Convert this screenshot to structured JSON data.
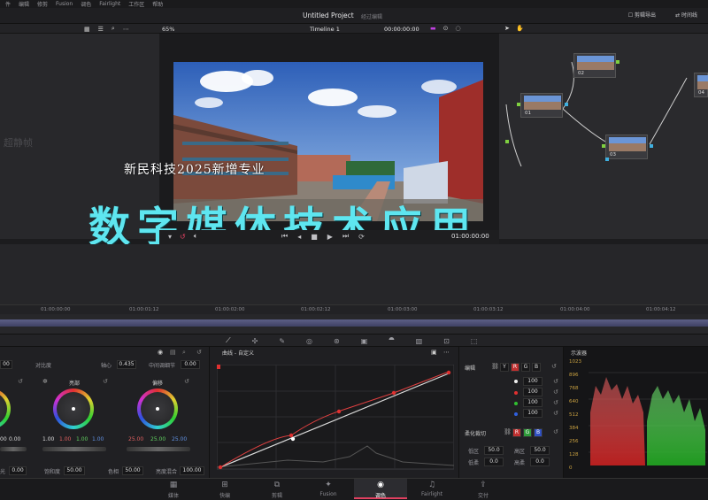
{
  "menubar": {
    "items": [
      "件",
      "编辑",
      "修剪",
      "Fusion",
      "调色",
      "Fairlight",
      "工作区",
      "帮助"
    ]
  },
  "titlebar": {
    "title": "Untitled Project",
    "subtitle": "经过编辑",
    "right": [
      "☐ 剪辑导出",
      "⇄ 时间线"
    ]
  },
  "viewer_toolbar": {
    "zoom": "65%",
    "timeline": "Timeline 1",
    "timecode": "00:00:00:00"
  },
  "gallery": {
    "ghost_text": "超静帧"
  },
  "overlay": {
    "caption_small": "新民科技2025新增专业",
    "caption_big": "数字媒体技术应用"
  },
  "playbar": {
    "timecode": "01:00:00:00"
  },
  "nodes": [
    {
      "label": "01"
    },
    {
      "label": "02"
    },
    {
      "label": "03"
    },
    {
      "label": "04"
    }
  ],
  "ruler": {
    "ticks": [
      "01:00:00:00",
      "01:00:01:12",
      "01:00:02:00",
      "01:00:02:12",
      "01:00:03:00",
      "01:00:03:12",
      "01:00:04:00",
      "01:00:04:12"
    ]
  },
  "wheels": {
    "top_labels": {
      "contrast_value": "00",
      "pivot_label": "对比度",
      "pivot": "轴心",
      "pivot_value": "0.435",
      "mid_label": "中间调细节",
      "mid_value": "0.00"
    },
    "wheel1": {
      "values": [
        "00",
        "0.00"
      ]
    },
    "wheel2": {
      "title": "亮部",
      "values": [
        "1.00",
        "1.00",
        "1.00",
        "1.00"
      ]
    },
    "wheel3": {
      "title": "偏移",
      "values": [
        "25.00",
        "25.00",
        "25.00"
      ]
    },
    "bottom": {
      "l1": "光",
      "v1": "0.00",
      "l2": "饱和度",
      "v2": "50.00",
      "l3": "色相",
      "v3": "50.00",
      "l4": "亮度混合",
      "v4": "100.00"
    }
  },
  "curves": {
    "title": "曲线 - 自定义"
  },
  "channels": {
    "title": "编辑",
    "buttons": [
      "Y",
      "R",
      "G",
      "B"
    ],
    "values": [
      "100",
      "100",
      "100",
      "100"
    ],
    "soft_title": "柔化裁切",
    "soft_buttons": [
      "R",
      "G",
      "B"
    ],
    "low_label": "低区",
    "low_value": "50.0",
    "high_label": "高区",
    "high_value": "50.0",
    "ls_label": "低柔",
    "ls_value": "0.0",
    "hs_label": "高柔",
    "hs_value": "0.0"
  },
  "scope": {
    "title": "示波器",
    "ticks": [
      "1023",
      "896",
      "768",
      "640",
      "512",
      "384",
      "256",
      "128",
      "0"
    ]
  },
  "pages": [
    {
      "icon": "▦",
      "label": "媒体"
    },
    {
      "icon": "⊞",
      "label": "快编"
    },
    {
      "icon": "⧉",
      "label": "剪辑"
    },
    {
      "icon": "✦",
      "label": "Fusion"
    },
    {
      "icon": "◉",
      "label": "调色"
    },
    {
      "icon": "♫",
      "label": "Fairlight"
    },
    {
      "icon": "⇪",
      "label": "交付"
    }
  ],
  "colors": {
    "accent": "#e04060",
    "caption": "#5ee6f0"
  }
}
